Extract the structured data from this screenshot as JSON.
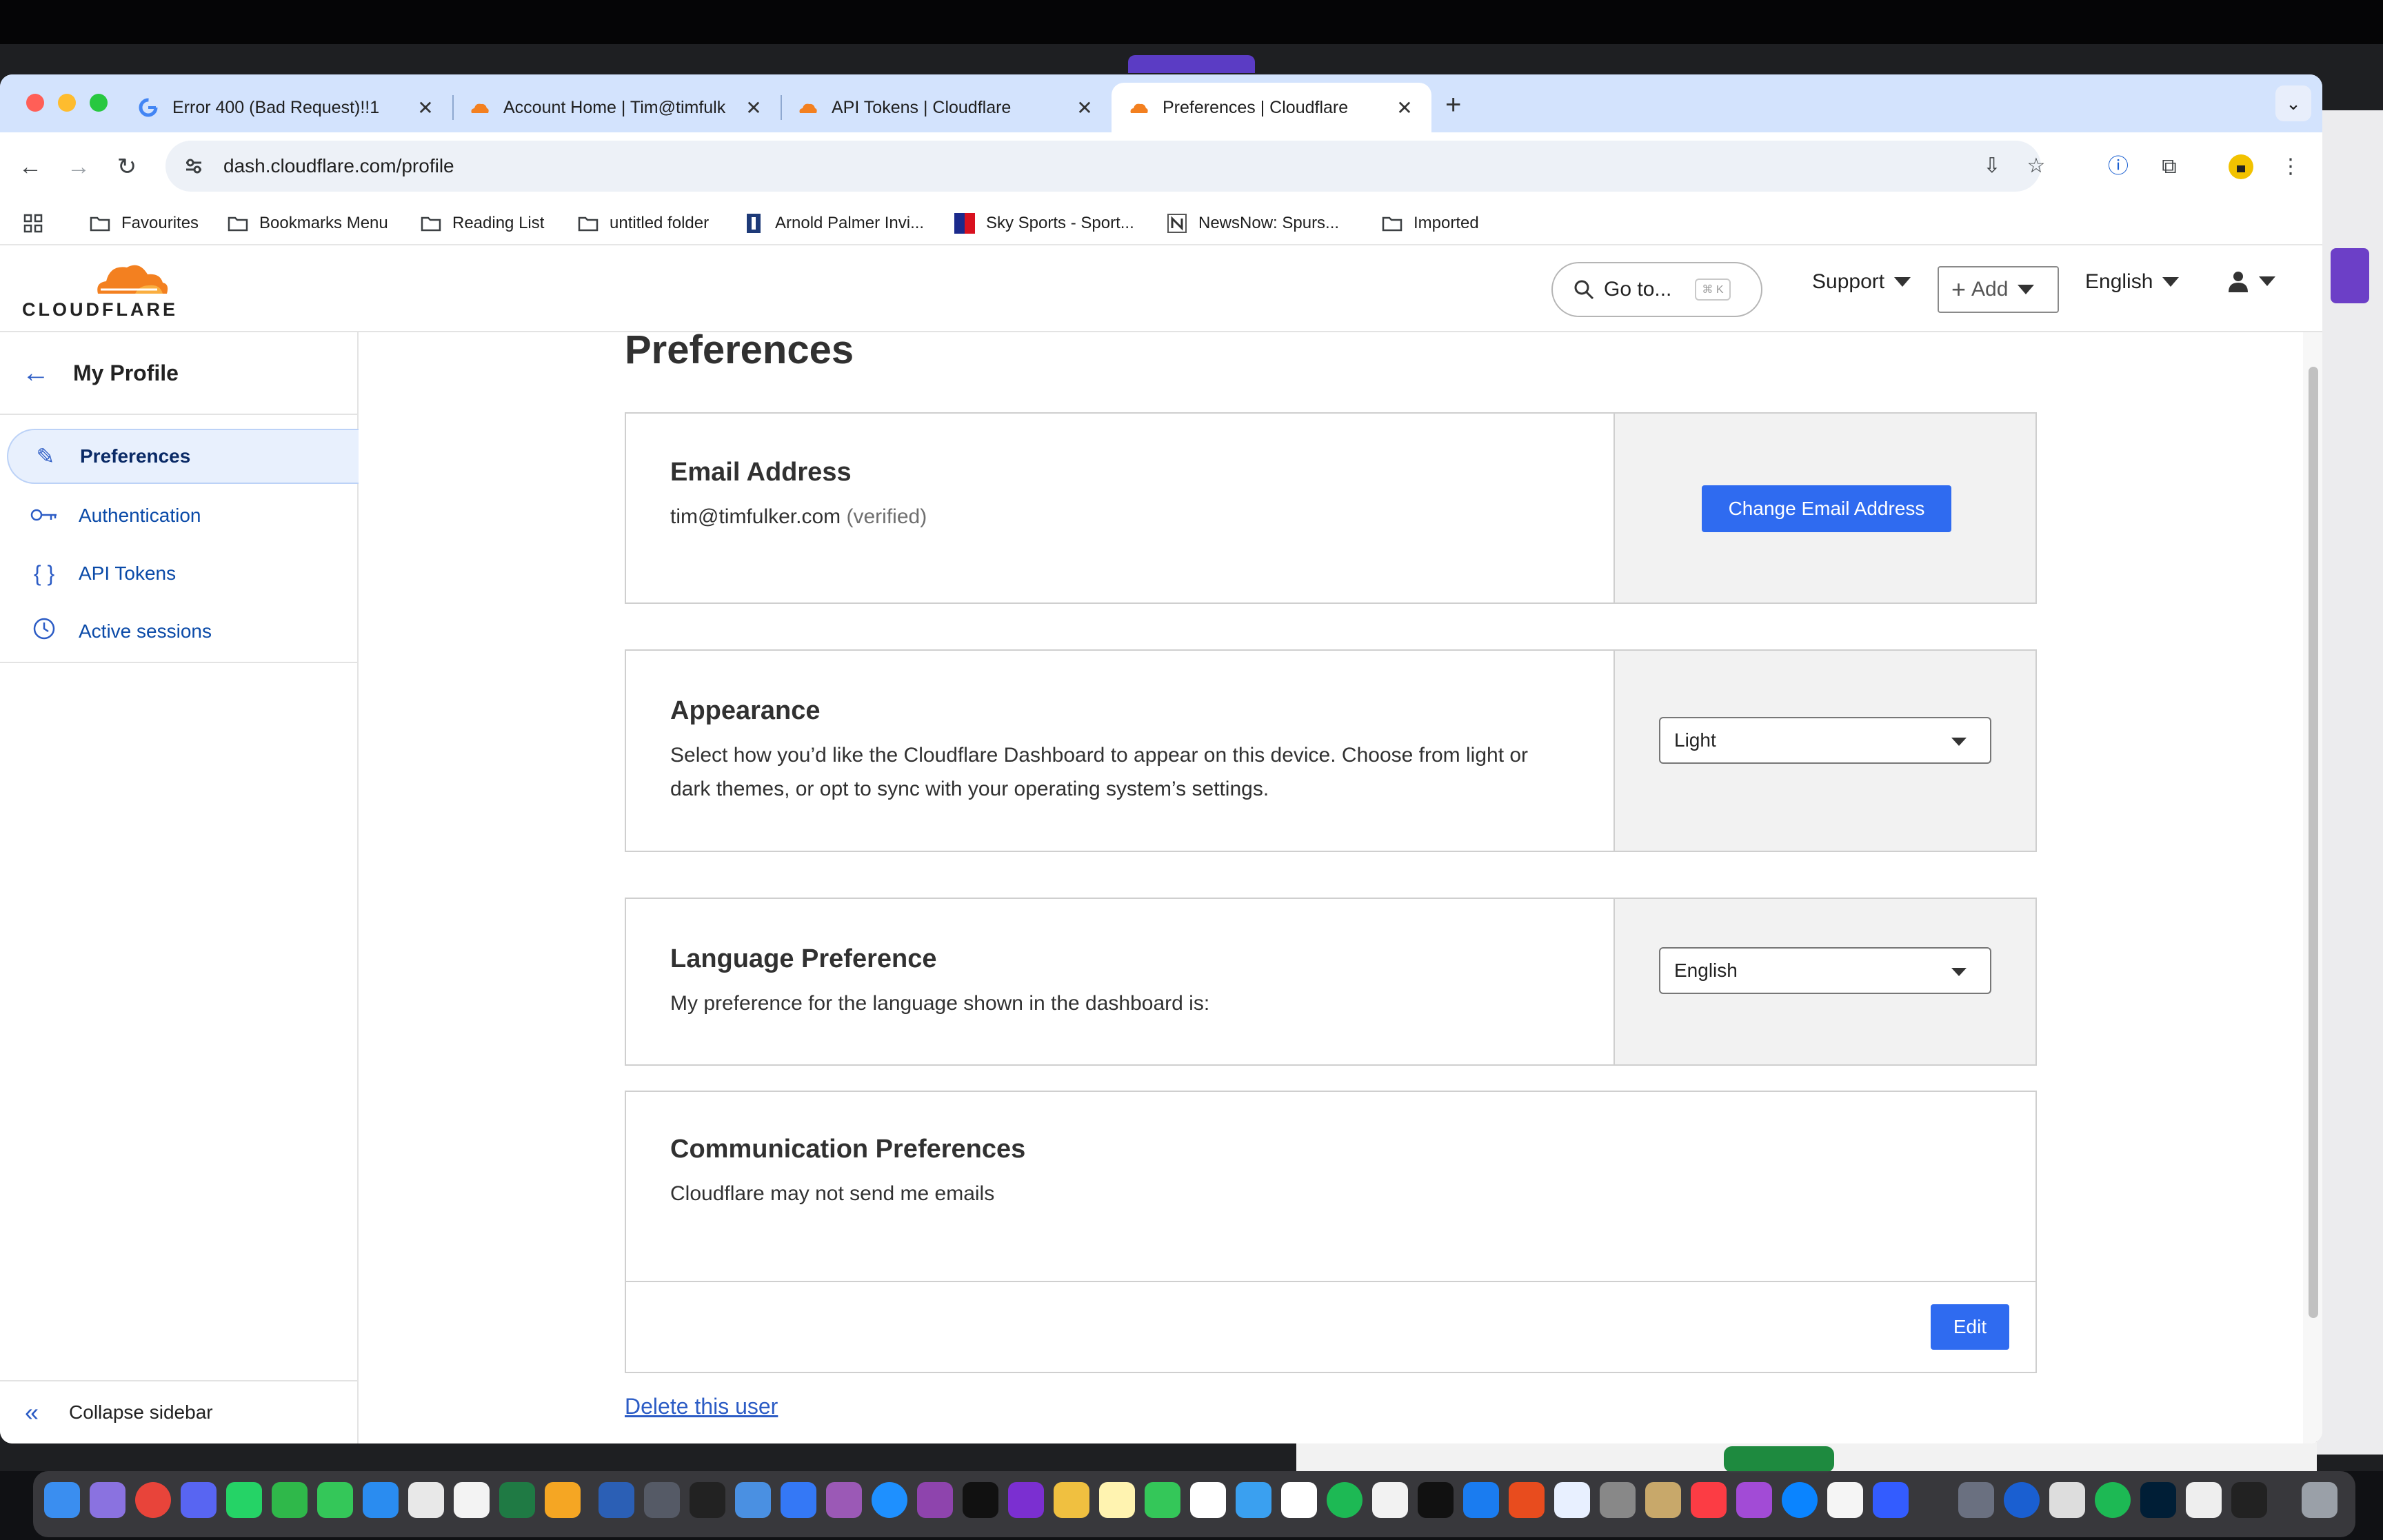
{
  "browser": {
    "tabs": [
      {
        "title": "Error 400 (Bad Request)!!1",
        "favicon": "google-icon"
      },
      {
        "title": "Account Home | Tim@timfulk",
        "favicon": "cloudflare-icon"
      },
      {
        "title": "API Tokens | Cloudflare",
        "favicon": "cloudflare-icon"
      },
      {
        "title": "Preferences | Cloudflare",
        "favicon": "cloudflare-icon",
        "active": true
      }
    ],
    "url": "dash.cloudflare.com/profile",
    "bookmarks": [
      {
        "label": "Favourites",
        "icon": "folder-icon"
      },
      {
        "label": "Bookmarks Menu",
        "icon": "folder-icon"
      },
      {
        "label": "Reading List",
        "icon": "folder-icon"
      },
      {
        "label": "untitled folder",
        "icon": "folder-icon"
      },
      {
        "label": "Arnold Palmer Invi...",
        "icon": "pga-icon"
      },
      {
        "label": "Sky Sports - Sport...",
        "icon": "sky-icon"
      },
      {
        "label": "NewsNow: Spurs...",
        "icon": "newsnow-icon"
      },
      {
        "label": "Imported",
        "icon": "folder-icon"
      }
    ]
  },
  "header": {
    "logo_text": "CLOUDFLARE",
    "goto_label": "Go to...",
    "goto_shortcut": "⌘ K",
    "support_label": "Support",
    "add_label": "Add",
    "language_label": "English"
  },
  "sidebar": {
    "title": "My Profile",
    "items": [
      {
        "label": "Preferences",
        "icon": "pencil-icon",
        "active": true
      },
      {
        "label": "Authentication",
        "icon": "key-icon"
      },
      {
        "label": "API Tokens",
        "icon": "braces-icon"
      },
      {
        "label": "Active sessions",
        "icon": "clock-icon"
      }
    ],
    "collapse_label": "Collapse sidebar"
  },
  "main": {
    "title": "Preferences",
    "email": {
      "heading": "Email Address",
      "address": "tim@timfulker.com",
      "status": "(verified)",
      "button": "Change Email Address"
    },
    "appearance": {
      "heading": "Appearance",
      "description": "Select how you’d like the Cloudflare Dashboard to appear on this device. Choose from light or dark themes, or opt to sync with your operating system’s settings.",
      "selected": "Light"
    },
    "language": {
      "heading": "Language Preference",
      "description": "My preference for the language shown in the dashboard is:",
      "selected": "English"
    },
    "communication": {
      "heading": "Communication Preferences",
      "description": "Cloudflare may not send me emails",
      "button": "Edit"
    },
    "delete_link": "Delete this user"
  },
  "colors": {
    "primary": "#2f6bf0",
    "link": "#2c5cc5",
    "cloudflare_orange": "#f38020",
    "tabstrip": "#d3e3fd"
  }
}
